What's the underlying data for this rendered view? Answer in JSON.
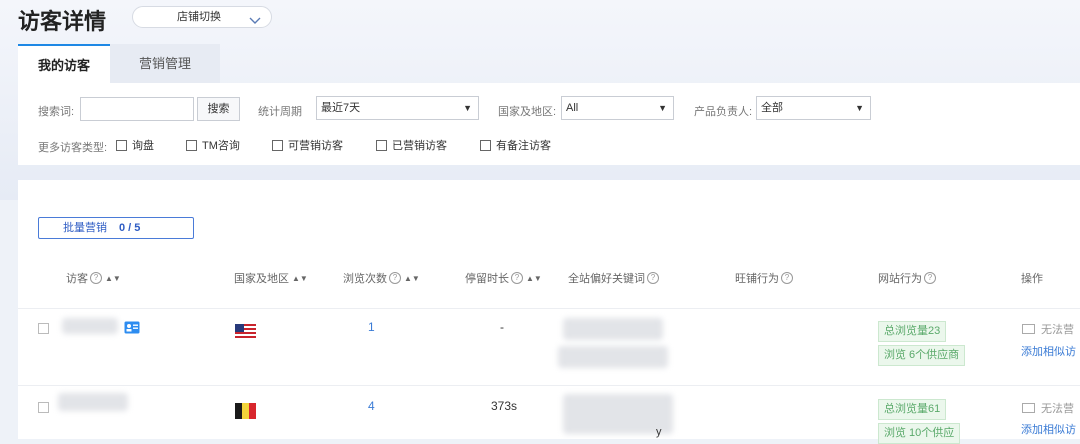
{
  "header": {
    "title": "访客详情",
    "shop_switch_label": "店铺切换"
  },
  "tabs": [
    {
      "label": "我的访客",
      "active": true
    },
    {
      "label": "营销管理",
      "active": false
    }
  ],
  "filters": {
    "search_label": "搜索词:",
    "search_value": "",
    "search_button": "搜索",
    "period_label": "统计周期",
    "period_value": "最近7天",
    "country_label": "国家及地区:",
    "country_value": "All",
    "owner_label": "产品负责人:",
    "owner_value": "全部",
    "more_types_label": "更多访客类型:",
    "types": [
      {
        "label": "询盘",
        "checked": false
      },
      {
        "label": "TM咨询",
        "checked": false
      },
      {
        "label": "可营销访客",
        "checked": false
      },
      {
        "label": "已营销访客",
        "checked": false
      },
      {
        "label": "有备注访客",
        "checked": false
      }
    ]
  },
  "batch": {
    "label": "批量营销",
    "count": "0 / 5"
  },
  "table": {
    "columns": [
      "访客",
      "国家及地区",
      "浏览次数",
      "停留时长",
      "全站偏好关键词",
      "旺铺行为",
      "网站行为",
      "操作"
    ],
    "rows": [
      {
        "country_flag": "us",
        "views": "1",
        "duration": "-",
        "keyword_tail": "",
        "site_tags": [
          "总浏览量23",
          "浏览 6个供应商"
        ],
        "op_status": "无法营",
        "op_link": "添加相似访"
      },
      {
        "country_flag": "be",
        "views": "4",
        "duration": "373s",
        "keyword_tail": "y",
        "site_tags": [
          "总浏览量61",
          "浏览 10个供应"
        ],
        "op_status": "无法营",
        "op_link": "添加相似访"
      }
    ]
  },
  "colors": {
    "accent": "#1e88e5",
    "link": "#3a7bd5",
    "tag_green": "#5aa96a"
  }
}
